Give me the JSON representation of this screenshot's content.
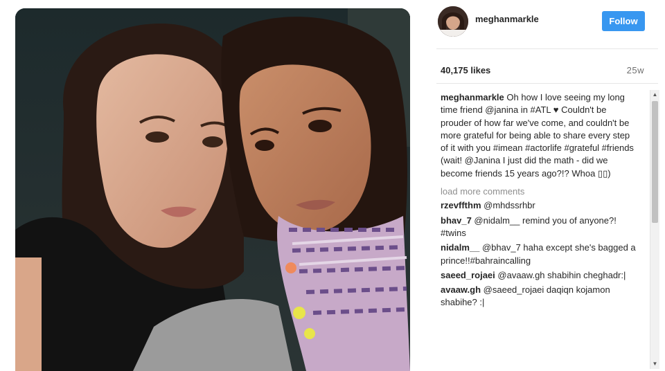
{
  "post": {
    "username": "meghanmarkle",
    "follow_label": "Follow",
    "likes": "40,175 likes",
    "age": "25w"
  },
  "caption": {
    "username": "meghanmarkle",
    "text": " Oh how I love seeing my long time friend @janina in #ATL ♥ Couldn't be prouder of how far we've come, and couldn't be more grateful for being able to share every step of it with you #imean #actorlife #grateful #friends (wait! @Janina I just did the math - did we become friends 15 years ago?!? Whoa ▯▯)"
  },
  "load_more_label": "load more comments",
  "comments": [
    {
      "username": "rzevffthm",
      "text": " @mhdssrhbr"
    },
    {
      "username": "bhav_7",
      "text": " @nidalm__ remind you of anyone?! #twins"
    },
    {
      "username": "nidalm__",
      "text": " @bhav_7 haha except she's bagged a prince!!#bahraincalling"
    },
    {
      "username": "saeed_rojaei",
      "text": " @avaaw.gh shabihin cheghadr:|"
    },
    {
      "username": "avaaw.gh",
      "text": " @saeed_rojaei daqiqn kojamon shabihe? :|"
    }
  ],
  "icons": {
    "scroll_up": "scroll-up-arrow-icon",
    "scroll_down": "scroll-down-arrow-icon"
  },
  "colors": {
    "follow_button": "#3897f0",
    "text": "#262626",
    "muted": "#8e8e8e"
  }
}
